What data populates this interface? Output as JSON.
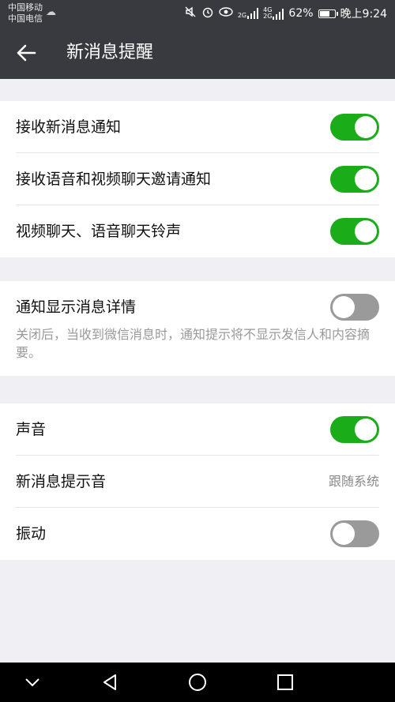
{
  "status_bar": {
    "carrier_1": "中国移动",
    "carrier_2": "中国电信",
    "battery": "62%",
    "time": "晚上9:24",
    "sig1": "2G",
    "sig2a": "4G",
    "sig2b": "2G"
  },
  "header": {
    "title": "新消息提醒"
  },
  "groups": [
    {
      "rows": [
        {
          "label": "接收新消息通知",
          "toggle": "on"
        },
        {
          "label": "接收语音和视频聊天邀请通知",
          "toggle": "on"
        },
        {
          "label": "视频聊天、语音聊天铃声",
          "toggle": "on"
        }
      ]
    },
    {
      "rows": [
        {
          "label": "通知显示消息详情",
          "toggle": "off"
        }
      ],
      "description": "关闭后，当收到微信消息时，通知提示将不显示发信人和内容摘要。"
    },
    {
      "rows": [
        {
          "label": "声音",
          "toggle": "on"
        },
        {
          "label": "新消息提示音",
          "value": "跟随系统"
        },
        {
          "label": "振动",
          "toggle": "off"
        }
      ]
    }
  ],
  "colors": {
    "switch_on": "#1aad19",
    "switch_off": "#9a9a9a",
    "header_bg": "#393a3f"
  }
}
